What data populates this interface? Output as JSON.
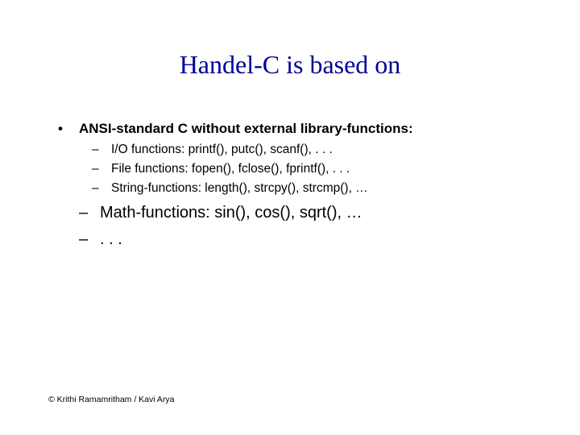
{
  "title": "Handel-C is based on",
  "main_bullet": "ANSI-standard C without external library-functions:",
  "sub_small": [
    "I/O functions: printf(), putc(), scanf(), . . .",
    "File functions: fopen(), fclose(), fprintf(), . . .",
    "String-functions: length(), strcpy(), strcmp(), …"
  ],
  "sub_large": [
    "Math-functions: sin(), cos(), sqrt(), …",
    ". . ."
  ],
  "footer": "© Krithi Ramamritham / Kavi Arya"
}
